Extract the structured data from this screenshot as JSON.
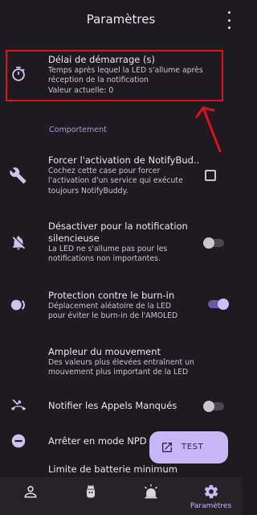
{
  "header": {
    "title": "Paramètres",
    "menu_icon": "more-vert-icon"
  },
  "settings": [
    {
      "title": "Délai de démarrage (s)",
      "summary": [
        "Temps après lequel la LED s'allume après",
        "réception de la notification",
        "Valeur actuelle: 0"
      ],
      "icon": "timer-icon",
      "highlighted": true
    },
    {
      "title": "Forcer l'activation de NotifyBud..",
      "summary": [
        "Cochez cette case pour forcer",
        "l'activation d'un service qui exécute",
        "toujours NotifyBuddy."
      ],
      "icon": "wrench-icon",
      "control": "checkbox",
      "checked": false
    },
    {
      "title_lines": [
        "Désactiver pour la notification",
        "silencieuse"
      ],
      "summary": [
        "La LED ne s'allume pas pour les",
        "notifications non importantes."
      ],
      "icon": "muted-bell-icon",
      "control": "switch",
      "on": false
    },
    {
      "title": "Protection contre le burn-in",
      "summary": [
        "Déplacement aléatoire de la LED",
        "pour éviter le burn-in de l'AMOLED"
      ],
      "icon": "burn-in-icon",
      "control": "switch",
      "on": true
    },
    {
      "title": "Ampleur du mouvement",
      "summary": [
        "Des valeurs plus élevées entraînent un",
        "mouvement plus important de la LED"
      ]
    },
    {
      "title": "Notifier les Appels Manqués",
      "icon": "missed-call-icon",
      "control": "switch",
      "on": false
    },
    {
      "title": "Arrêter en mode NPD",
      "icon": "do-not-disturb-icon"
    },
    {
      "title": "Limite de batterie minimum"
    }
  ],
  "section": {
    "title": "Comportement"
  },
  "fab": {
    "label": "TEST",
    "icon": "open-external-icon"
  },
  "bottom_nav": [
    {
      "icon": "person-icon",
      "label": ""
    },
    {
      "icon": "android-icon",
      "label": ""
    },
    {
      "icon": "alert-icon",
      "label": ""
    },
    {
      "icon": "settings-icon",
      "label": "Paramètres",
      "selected": true
    }
  ],
  "colors": {
    "background": "#1d1b20",
    "accent": "#d0bcff",
    "section": "#a99bdc",
    "highlight_box": "#e0101a",
    "arrow": "#e0101a"
  }
}
